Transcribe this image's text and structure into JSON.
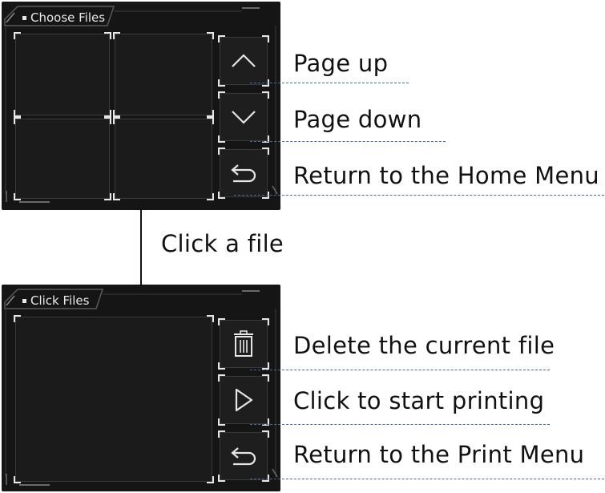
{
  "screen_top": {
    "title": "Choose Files",
    "buttons": [
      {
        "name": "page-up",
        "icon": "chevron-up-icon"
      },
      {
        "name": "page-down",
        "icon": "chevron-down-icon"
      },
      {
        "name": "return",
        "icon": "return-arrow-icon"
      }
    ]
  },
  "screen_bottom": {
    "title": "Click Files",
    "buttons": [
      {
        "name": "delete",
        "icon": "trash-icon"
      },
      {
        "name": "print",
        "icon": "play-icon"
      },
      {
        "name": "return",
        "icon": "return-arrow-icon"
      }
    ]
  },
  "annotations": {
    "page_up": "Page up",
    "page_down": "Page down",
    "return_home": "Return to the Home Menu",
    "click_file": "Click a file",
    "delete_file": "Delete the current file",
    "start_printing": "Click to start printing",
    "return_print": "Return to the Print Menu"
  },
  "colors": {
    "screen_bg": "#151516",
    "leader_line": "#4a6a9a",
    "ui_text": "#e8e8e8"
  }
}
